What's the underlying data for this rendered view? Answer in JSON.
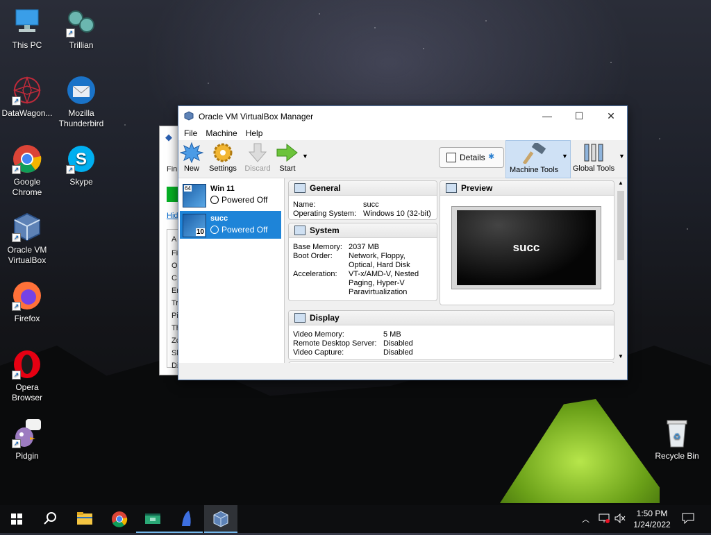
{
  "desktop": {
    "icons": [
      {
        "label_1": "This PC",
        "label_2": ""
      },
      {
        "label_1": "Trillian",
        "label_2": ""
      },
      {
        "label_1": "DataWagon...",
        "label_2": ""
      },
      {
        "label_1": "Mozilla",
        "label_2": "Thunderbird"
      },
      {
        "label_1": "Google",
        "label_2": "Chrome"
      },
      {
        "label_1": "Skype",
        "label_2": ""
      },
      {
        "label_1": "Oracle VM",
        "label_2": "VirtualBox"
      },
      {
        "label_1": "Firefox",
        "label_2": ""
      },
      {
        "label_1": "Opera",
        "label_2": "Browser"
      },
      {
        "label_1": "Pidgin",
        "label_2": ""
      },
      {
        "label_1": "Recycle Bin",
        "label_2": ""
      }
    ]
  },
  "background_window": {
    "lines": [
      "Fini",
      "Hid",
      "A",
      "Fi",
      "O",
      "C",
      "Er",
      "Tr",
      "Pi",
      "Th",
      "Zc",
      "Sh",
      "Di"
    ]
  },
  "vbox": {
    "title": "Oracle VM VirtualBox Manager",
    "window_controls": {
      "minimize": "—",
      "maximize": "☐",
      "close": "✕"
    },
    "menu": [
      "File",
      "Machine",
      "Help"
    ],
    "toolbar": {
      "new": "New",
      "settings": "Settings",
      "discard": "Discard",
      "start": "Start",
      "details": "Details",
      "machine_tools": "Machine Tools",
      "global_tools": "Global Tools"
    },
    "vms": [
      {
        "name": "Win 11",
        "state": "Powered Off",
        "badge": "64",
        "selected": false
      },
      {
        "name": "succ",
        "state": "Powered Off",
        "badge": "10",
        "selected": true
      }
    ],
    "general": {
      "title": "General",
      "rows": [
        {
          "k": "Name:",
          "v": "succ"
        },
        {
          "k": "Operating System:",
          "v": "Windows 10 (32-bit)"
        }
      ]
    },
    "system": {
      "title": "System",
      "rows": [
        {
          "k": "Base Memory:",
          "v": "2037 MB"
        },
        {
          "k": "Boot Order:",
          "v": "Network, Floppy, Optical, Hard Disk"
        },
        {
          "k": "Acceleration:",
          "v": "VT-x/AMD-V, Nested Paging, Hyper-V Paravirtualization"
        }
      ]
    },
    "preview": {
      "title": "Preview",
      "screen_text": "succ"
    },
    "display": {
      "title": "Display",
      "rows": [
        {
          "k": "Video Memory:",
          "v": "5 MB"
        },
        {
          "k": "Remote Desktop Server:",
          "v": "Disabled"
        },
        {
          "k": "Video Capture:",
          "v": "Disabled"
        }
      ]
    }
  },
  "taskbar": {
    "time": "1:50 PM",
    "date": "1/24/2022",
    "apps": [
      "start",
      "search",
      "file-explorer",
      "chrome",
      "app",
      "pidgin",
      "virtualbox"
    ]
  },
  "colors": {
    "accent": "#1e84d8",
    "taskbar": "#0d0e10",
    "tent": "#8bc832"
  }
}
